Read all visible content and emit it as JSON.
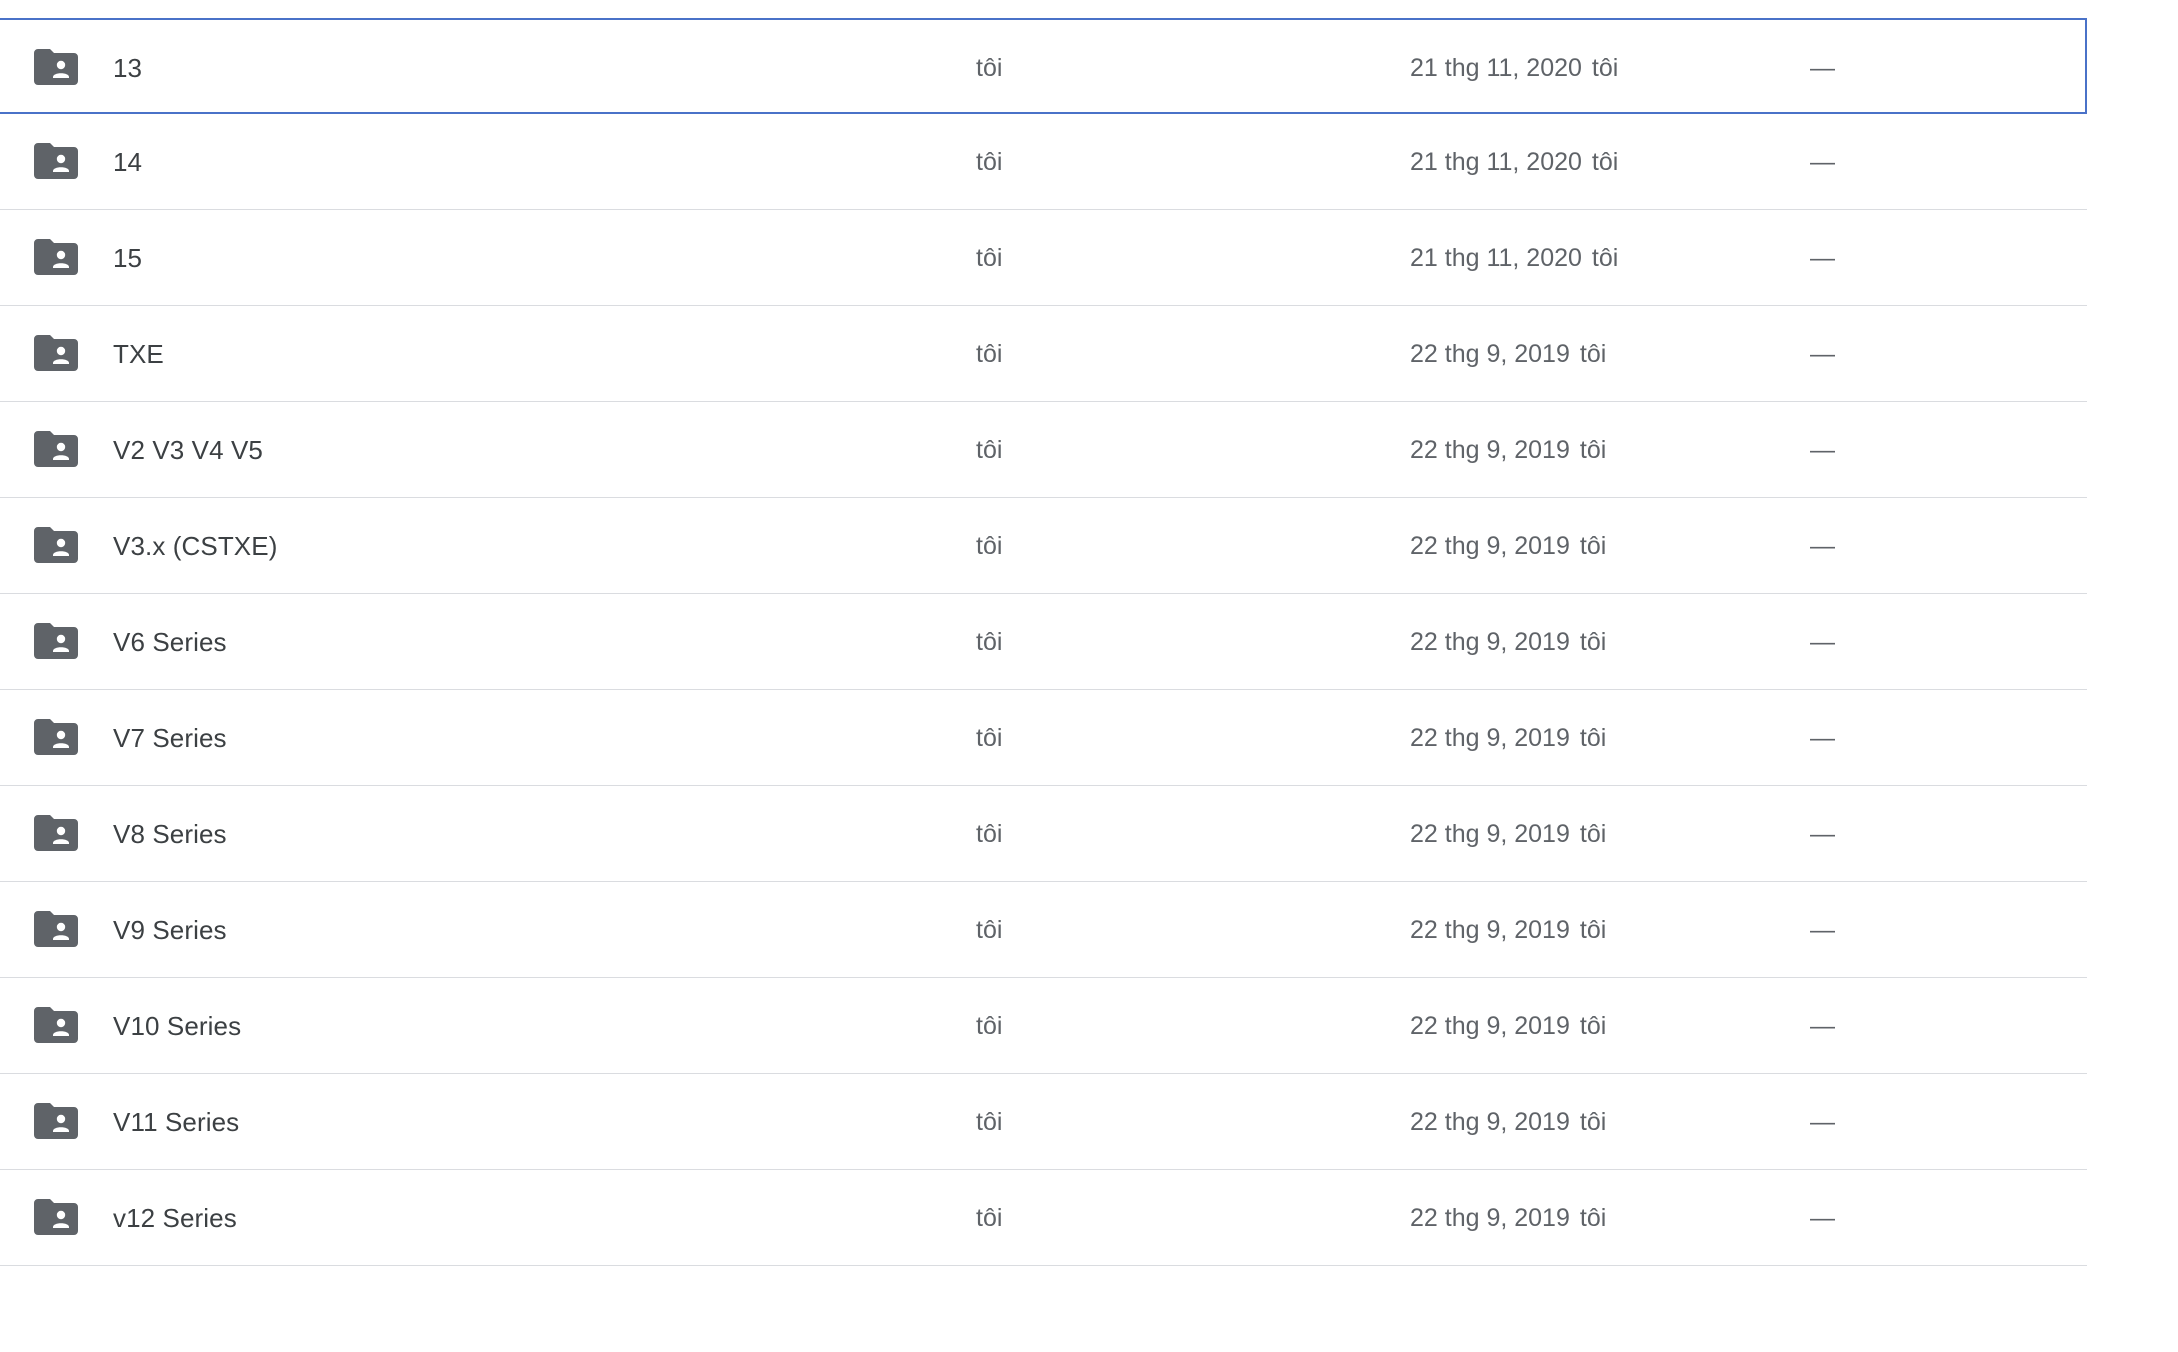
{
  "folder_icon_color": "#5f6368",
  "selected_border_color": "#4a72c8",
  "rows": [
    {
      "name": "13",
      "owner": "tôi",
      "modified_date": "21 thg 11, 2020",
      "modified_by": "tôi",
      "size": "—",
      "selected": true
    },
    {
      "name": "14",
      "owner": "tôi",
      "modified_date": "21 thg 11, 2020",
      "modified_by": "tôi",
      "size": "—"
    },
    {
      "name": "15",
      "owner": "tôi",
      "modified_date": "21 thg 11, 2020",
      "modified_by": "tôi",
      "size": "—"
    },
    {
      "name": "TXE",
      "owner": "tôi",
      "modified_date": "22 thg 9, 2019",
      "modified_by": "tôi",
      "size": "—"
    },
    {
      "name": "V2 V3 V4 V5",
      "owner": "tôi",
      "modified_date": "22 thg 9, 2019",
      "modified_by": "tôi",
      "size": "—"
    },
    {
      "name": "V3.x (CSTXE)",
      "owner": "tôi",
      "modified_date": "22 thg 9, 2019",
      "modified_by": "tôi",
      "size": "—"
    },
    {
      "name": "V6 Series",
      "owner": "tôi",
      "modified_date": "22 thg 9, 2019",
      "modified_by": "tôi",
      "size": "—"
    },
    {
      "name": "V7 Series",
      "owner": "tôi",
      "modified_date": "22 thg 9, 2019",
      "modified_by": "tôi",
      "size": "—"
    },
    {
      "name": "V8 Series",
      "owner": "tôi",
      "modified_date": "22 thg 9, 2019",
      "modified_by": "tôi",
      "size": "—"
    },
    {
      "name": "V9 Series",
      "owner": "tôi",
      "modified_date": "22 thg 9, 2019",
      "modified_by": "tôi",
      "size": "—"
    },
    {
      "name": "V10 Series",
      "owner": "tôi",
      "modified_date": "22 thg 9, 2019",
      "modified_by": "tôi",
      "size": "—"
    },
    {
      "name": "V11 Series",
      "owner": "tôi",
      "modified_date": "22 thg 9, 2019",
      "modified_by": "tôi",
      "size": "—"
    },
    {
      "name": "v12 Series",
      "owner": "tôi",
      "modified_date": "22 thg 9, 2019",
      "modified_by": "tôi",
      "size": "—"
    }
  ]
}
